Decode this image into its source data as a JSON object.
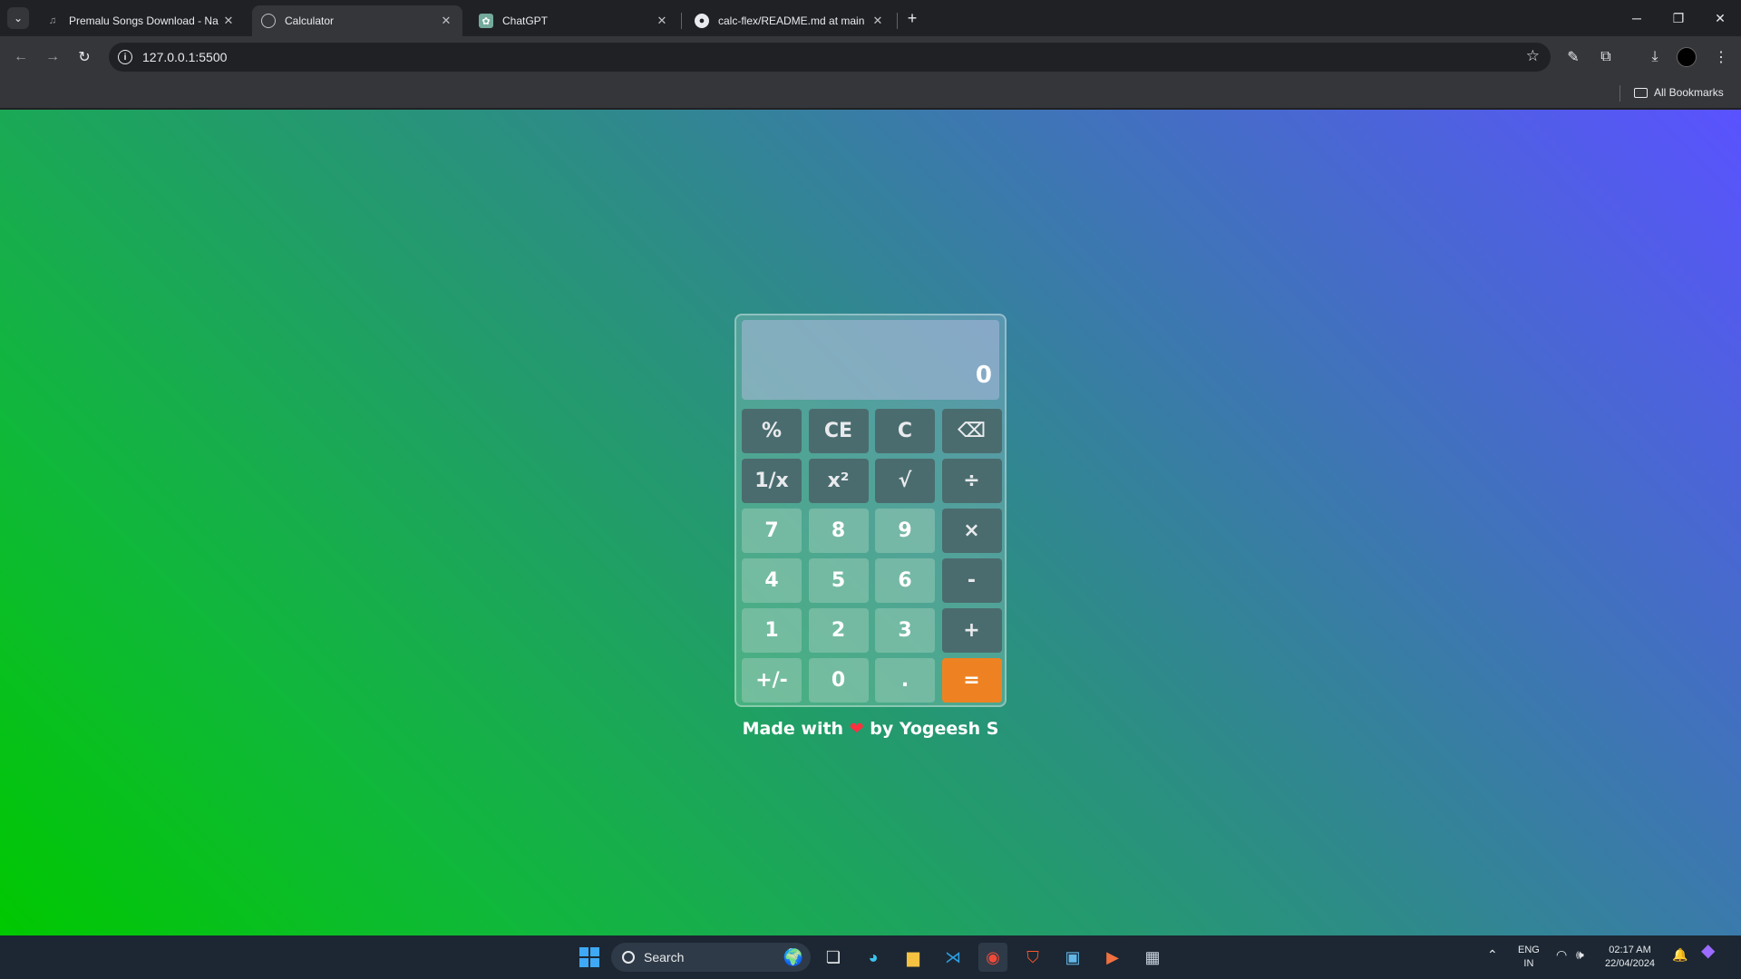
{
  "browser": {
    "tabs": [
      {
        "title": "Premalu Songs Download - Na",
        "active": false
      },
      {
        "title": "Calculator",
        "active": true
      },
      {
        "title": "ChatGPT",
        "active": false
      },
      {
        "title": "calc-flex/README.md at main",
        "active": false
      }
    ],
    "new_tab": "+",
    "url": "127.0.0.1:5500",
    "bookmarks_label": "All Bookmarks"
  },
  "calculator": {
    "display": "0",
    "keys": [
      "%",
      "CE",
      "C",
      "⌫",
      "1/x",
      "x²",
      "√",
      "÷",
      "7",
      "8",
      "9",
      "×",
      "4",
      "5",
      "6",
      "-",
      "1",
      "2",
      "3",
      "+",
      "+/-",
      "0",
      ".",
      "="
    ],
    "footer_before": "Made with",
    "footer_heart": "❤",
    "footer_after": "by Yogeesh S"
  },
  "taskbar": {
    "search_label": "Search",
    "lang_top": "ENG",
    "lang_bottom": "IN",
    "time": "02:17 AM",
    "date": "22/04/2024"
  },
  "colors": {
    "equals_key": "#ee8222",
    "function_key": "#4a6c6e",
    "gradient_top_right": "#5a52ff",
    "gradient_bottom_left": "#00c800"
  }
}
